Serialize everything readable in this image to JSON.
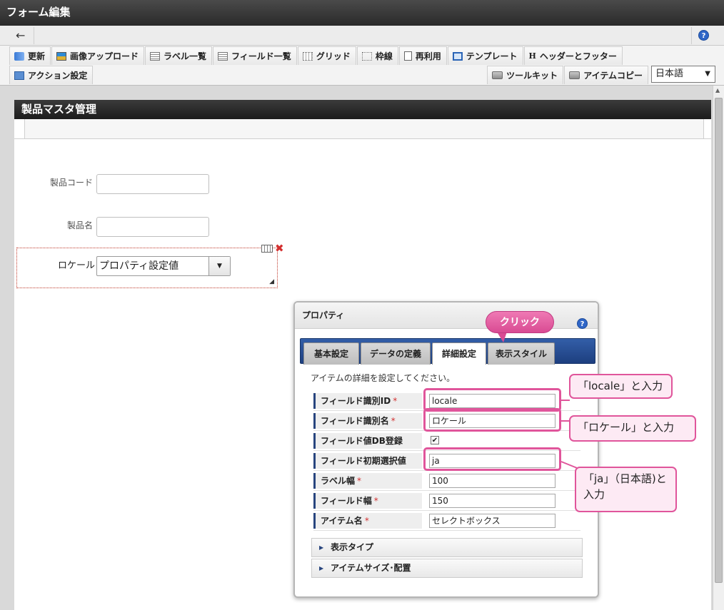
{
  "window": {
    "title": "フォーム編集"
  },
  "nav": {
    "back_glyph": "🡐",
    "help_glyph": "?"
  },
  "toolbar": {
    "row1": [
      {
        "label": "更新",
        "icon": "refresh-icon"
      },
      {
        "label": "画像アップロード",
        "icon": "image-upload-icon"
      },
      {
        "label": "ラベル一覧",
        "icon": "list-icon"
      },
      {
        "label": "フィールド一覧",
        "icon": "list-icon"
      },
      {
        "label": "グリッド",
        "icon": "grid-icon"
      },
      {
        "label": "枠線",
        "icon": "frame-icon"
      },
      {
        "label": "再利用",
        "icon": "document-icon"
      },
      {
        "label": "テンプレート",
        "icon": "template-icon"
      },
      {
        "label": "ヘッダーとフッター",
        "icon": "header-footer-icon",
        "glyph": "H"
      }
    ],
    "row2": [
      {
        "label": "アクション設定",
        "icon": "action-icon"
      }
    ],
    "right": [
      {
        "label": "ツールキット",
        "icon": "toolbox-icon"
      },
      {
        "label": "アイテムコピー",
        "icon": "toolbox-icon"
      }
    ],
    "language": {
      "selected": "日本語",
      "arrow": "▼"
    }
  },
  "form": {
    "title": "製品マスタ管理",
    "fields": [
      {
        "label": "製品コード",
        "value": ""
      },
      {
        "label": "製品名",
        "value": ""
      }
    ],
    "locale_item": {
      "label": "ロケール",
      "value": "プロパティ設定値",
      "arrow": "▼",
      "resize": "◢",
      "close": "✖"
    }
  },
  "panel": {
    "title": "プロパティ",
    "help": "?",
    "tabs": [
      "基本設定",
      "データの定義",
      "詳細設定",
      "表示スタイル"
    ],
    "active_tab": "詳細設定",
    "description": "アイテムの詳細を設定してください。",
    "rows": [
      {
        "label": "フィールド識別ID",
        "required": "*",
        "value": "locale"
      },
      {
        "label": "フィールド識別名",
        "required": "*",
        "value": "ロケール"
      },
      {
        "label": "フィールド値DB登録",
        "required": "",
        "checked": "✔"
      },
      {
        "label": "フィールド初期選択値",
        "required": "",
        "value": "ja"
      },
      {
        "label": "ラベル幅",
        "required": "*",
        "value": "100"
      },
      {
        "label": "フィールド幅",
        "required": "*",
        "value": "150"
      },
      {
        "label": "アイテム名",
        "required": "*",
        "value": "セレクトボックス"
      }
    ],
    "accordions": [
      "表示タイプ",
      "アイテムサイズ･配置"
    ],
    "accordion_arrow": "▶"
  },
  "annotations": {
    "click": "クリック",
    "callout_id": "「locale」と入力",
    "callout_name": "「ロケール」と入力",
    "callout_default_line1": "「ja」（日本語)と",
    "callout_default_line2": "入力",
    "accent_color": "#e0559b"
  },
  "scrollbar": {
    "up": "▲"
  }
}
